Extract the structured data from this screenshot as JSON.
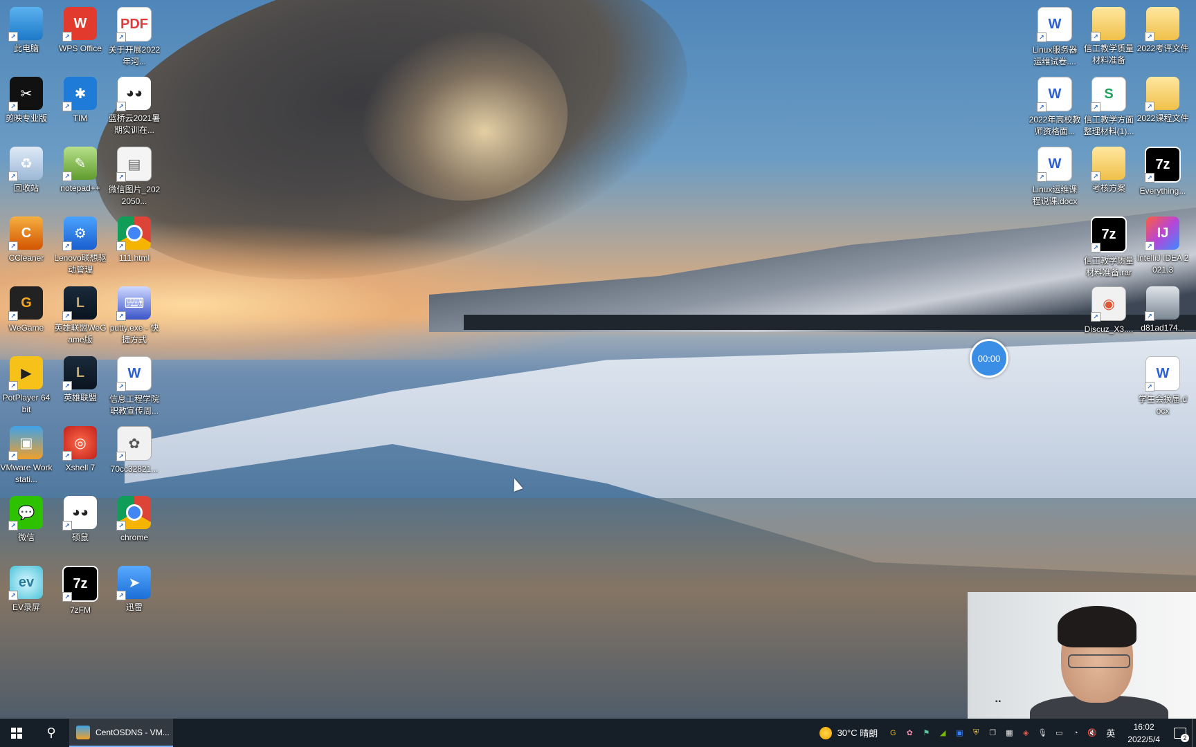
{
  "desktop": {
    "left_icons": [
      {
        "label": "此电脑",
        "glyph": "",
        "style": "g-pc",
        "icon": "computer-icon"
      },
      {
        "label": "WPS Office",
        "glyph": "W",
        "style": "g-wps",
        "icon": "wps-office-icon"
      },
      {
        "label": "关于开展2022年河...",
        "glyph": "PDF",
        "style": "g-pdf",
        "icon": "pdf-file-icon"
      },
      {
        "label": "剪映专业版",
        "glyph": "✂",
        "style": "g-jy",
        "icon": "capcut-icon"
      },
      {
        "label": "TIM",
        "glyph": "✱",
        "style": "g-tim",
        "icon": "tim-icon"
      },
      {
        "label": "蓝桥云2021暑期实训在...",
        "glyph": "◕◕",
        "style": "g-lq",
        "icon": "lanqiao-icon"
      },
      {
        "label": "回收站",
        "glyph": "♻",
        "style": "g-bin",
        "icon": "recycle-bin-icon"
      },
      {
        "label": "notepad++",
        "glyph": "✎",
        "style": "g-np",
        "icon": "notepad-plus-icon"
      },
      {
        "label": "微信图片_2022050...",
        "glyph": "▤",
        "style": "g-img",
        "icon": "image-file-icon"
      },
      {
        "label": "CCleaner",
        "glyph": "C",
        "style": "g-cc",
        "icon": "ccleaner-icon"
      },
      {
        "label": "Lenovo联想驱动管理",
        "glyph": "⚙",
        "style": "g-lenovo",
        "icon": "lenovo-driver-icon"
      },
      {
        "label": "111.html",
        "glyph": "",
        "style": "g-chrome",
        "icon": "chrome-html-icon"
      },
      {
        "label": "WeGame",
        "glyph": "G",
        "style": "g-wegame",
        "icon": "wegame-icon"
      },
      {
        "label": "英雄联盟WeGame版",
        "glyph": "L",
        "style": "g-lol",
        "icon": "league-of-legends-icon"
      },
      {
        "label": "putty.exe - 快捷方式",
        "glyph": "⌨",
        "style": "g-putty",
        "icon": "putty-icon"
      },
      {
        "label": "PotPlayer 64 bit",
        "glyph": "▶",
        "style": "g-pot",
        "icon": "potplayer-icon"
      },
      {
        "label": "英雄联盟",
        "glyph": "L",
        "style": "g-lol",
        "icon": "league-of-legends-icon"
      },
      {
        "label": "信息工程学院职教宣传周...",
        "glyph": "W",
        "style": "g-word",
        "icon": "word-document-icon"
      },
      {
        "label": "VMware Workstati...",
        "glyph": "▣",
        "style": "g-vm",
        "icon": "vmware-icon"
      },
      {
        "label": "Xshell 7",
        "glyph": "◎",
        "style": "g-xshell",
        "icon": "xshell-icon"
      },
      {
        "label": "70cc32821...",
        "glyph": "✿",
        "style": "g-70cc",
        "icon": "image-file-icon"
      },
      {
        "label": "微信",
        "glyph": "💬",
        "style": "g-wx",
        "icon": "wechat-icon"
      },
      {
        "label": "硕鼠",
        "glyph": "◕◕",
        "style": "g-lq",
        "icon": "flvcd-icon"
      },
      {
        "label": "chrome",
        "glyph": "",
        "style": "g-chrome",
        "icon": "chrome-icon"
      },
      {
        "label": "EV录屏",
        "glyph": "ev",
        "style": "g-ev",
        "icon": "ev-recorder-icon"
      },
      {
        "label": "7zFM",
        "glyph": "7z",
        "style": "g-7z",
        "icon": "7zip-icon"
      },
      {
        "label": "迅雷",
        "glyph": "➤",
        "style": "g-xl",
        "icon": "xunlei-icon"
      }
    ],
    "right_icons": [
      {
        "label": "Linux服务器运维试卷....",
        "glyph": "W",
        "style": "g-word",
        "icon": "word-document-icon"
      },
      {
        "label": "信工教学质量材料准备",
        "glyph": "",
        "style": "g-folder",
        "icon": "folder-icon"
      },
      {
        "label": "2022考评文件",
        "glyph": "",
        "style": "g-folder",
        "icon": "folder-icon"
      },
      {
        "label": "2022年高校教师资格面...",
        "glyph": "W",
        "style": "g-word",
        "icon": "word-document-icon"
      },
      {
        "label": "信工教学方面整理材料(1)...",
        "glyph": "S",
        "style": "g-xls",
        "icon": "spreadsheet-icon"
      },
      {
        "label": "2022课程文件",
        "glyph": "",
        "style": "g-folder",
        "icon": "folder-icon"
      },
      {
        "label": "Linux运维课程说课.docx",
        "glyph": "W",
        "style": "g-word",
        "icon": "word-document-icon"
      },
      {
        "label": "考核方案",
        "glyph": "",
        "style": "g-folder",
        "icon": "folder-icon"
      },
      {
        "label": "Everything...",
        "glyph": "7z",
        "style": "g-7z",
        "icon": "7zip-archive-icon"
      },
      {
        "label": "信工教学质量材料准备.rar",
        "glyph": "7z",
        "style": "g-7z",
        "icon": "7zip-archive-icon"
      },
      {
        "label": "IntelliJ IDEA 2021.3",
        "glyph": "IJ",
        "style": "g-idea",
        "icon": "intellij-idea-icon"
      },
      {
        "label": "Discuz_X3....",
        "glyph": "◉",
        "style": "g-disc",
        "icon": "archive-file-icon"
      },
      {
        "label": "d81ad174...",
        "glyph": "",
        "style": "g-photo",
        "icon": "photo-file-icon"
      },
      {
        "label": "学生会换届.docx",
        "glyph": "W",
        "style": "g-word",
        "icon": "word-document-icon"
      }
    ]
  },
  "timer": {
    "text": "00:00"
  },
  "webcam": {
    "indicator": "▪▪"
  },
  "taskbar": {
    "search_glyph": "⚲",
    "app_label": "CentOSDNS - VM...",
    "weather_temp": "30°C",
    "weather_desc": "晴朗",
    "ime": "英",
    "time": "16:02",
    "date": "2022/5/4",
    "notif_count": "2",
    "tray_icons": [
      {
        "name": "g-tray-icon",
        "glyph": "G",
        "color": "#e8b01c"
      },
      {
        "name": "flower-tray-icon",
        "glyph": "✿",
        "color": "#f28aa8"
      },
      {
        "name": "flag-tray-icon",
        "glyph": "⚑",
        "color": "#5cc5a0"
      },
      {
        "name": "nvidia-tray-icon",
        "glyph": "◢",
        "color": "#76b900"
      },
      {
        "name": "app-tray-icon",
        "glyph": "▣",
        "color": "#3b82f6"
      },
      {
        "name": "shield-tray-icon",
        "glyph": "⛨",
        "color": "#f5c242"
      },
      {
        "name": "window-tray-icon",
        "glyph": "❐",
        "color": "#cccccc"
      },
      {
        "name": "wechat-tray-icon",
        "glyph": "▦",
        "color": "#eeeeee"
      },
      {
        "name": "sync-tray-icon",
        "glyph": "◈",
        "color": "#e85a4f"
      },
      {
        "name": "mic-tray-icon",
        "glyph": "🎙",
        "color": "#dddddd"
      },
      {
        "name": "battery-tray-icon",
        "glyph": "▭",
        "color": "#dddddd"
      },
      {
        "name": "wifi-tray-icon",
        "glyph": "◔",
        "color": "#dddddd"
      },
      {
        "name": "volume-muted-tray-icon",
        "glyph": "🔇",
        "color": "#dddddd"
      }
    ]
  }
}
